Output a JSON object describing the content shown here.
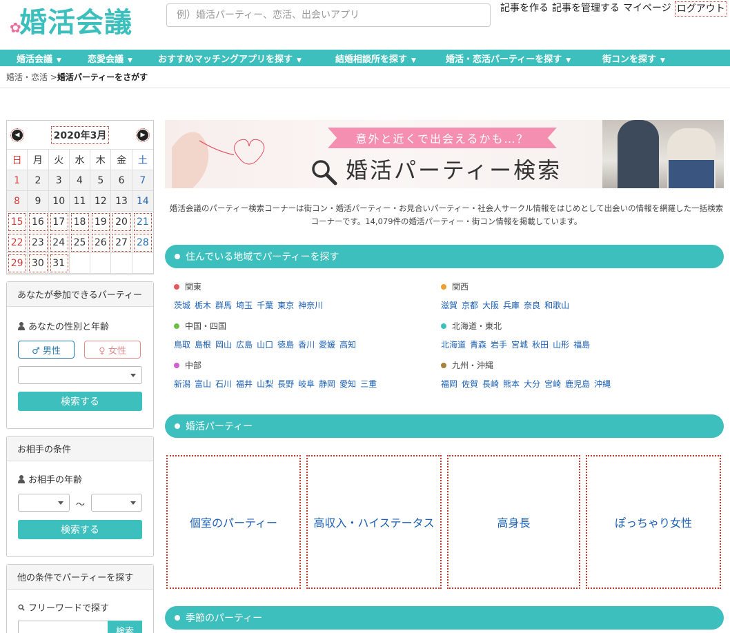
{
  "logo": {
    "text": "婚活会議",
    "flower": "✿"
  },
  "search": {
    "placeholder": "例）婚活パーティー、恋活、出会いアプリ"
  },
  "toplinks": [
    "記事を作る",
    "記事を管理する",
    "マイページ",
    "ログアウト"
  ],
  "nav": [
    "婚活会議",
    "恋愛会議",
    "おすすめマッチングアプリを探す",
    "結婚相談所を探す",
    "婚活・恋活パーティーを探す",
    "街コンを探す"
  ],
  "breadcrumb": {
    "parent": "婚活・恋活",
    "sep": ">",
    "current": "婚活パーティーをさがす"
  },
  "calendar": {
    "title": "2020年3月",
    "dow": [
      "日",
      "月",
      "火",
      "水",
      "木",
      "金",
      "土"
    ],
    "days": [
      "1",
      "2",
      "3",
      "4",
      "5",
      "6",
      "7",
      "8",
      "9",
      "10",
      "11",
      "12",
      "13",
      "14",
      "15",
      "16",
      "17",
      "18",
      "19",
      "20",
      "21",
      "22",
      "23",
      "24",
      "25",
      "26",
      "27",
      "28",
      "29",
      "30",
      "31"
    ]
  },
  "box1": {
    "title": "あなたが参加できるパーティー",
    "label": "あなたの性別と年齢",
    "male": "♂ 男性",
    "female": "♀ 女性",
    "search": "検索する"
  },
  "box2": {
    "title": "お相手の条件",
    "label": "お相手の年齢",
    "tilde": "～",
    "search": "検索する"
  },
  "box3": {
    "title": "他の条件でパーティーを探す",
    "label": "フリーワードで探す",
    "search": "検索"
  },
  "banner": {
    "pill": "意外と近くで出会えるかも…？",
    "title": "婚活パーティー検索"
  },
  "intro": "婚活会議のパーティー検索コーナーは街コン・婚活パーティー・お見合いパーティー・社会人サークル情報をはじめとして出会いの情報を網羅した一括検索コーナーです。14,079件の婚活パーティー・街コン情報を掲載しています。",
  "sections": {
    "area": "住んでいる地域でパーティーを探す",
    "party": "婚活パーティー",
    "season": "季節のパーティー"
  },
  "regions": [
    {
      "name": "関東",
      "color": "#e85a5a",
      "prefs": [
        "茨城",
        "栃木",
        "群馬",
        "埼玉",
        "千葉",
        "東京",
        "神奈川"
      ]
    },
    {
      "name": "関西",
      "color": "#f0a030",
      "prefs": [
        "滋賀",
        "京都",
        "大阪",
        "兵庫",
        "奈良",
        "和歌山"
      ]
    },
    {
      "name": "中国・四国",
      "color": "#6cc04a",
      "prefs": [
        "鳥取",
        "島根",
        "岡山",
        "広島",
        "山口",
        "徳島",
        "香川",
        "愛媛",
        "高知"
      ]
    },
    {
      "name": "北海道・東北",
      "color": "#3cbfbd",
      "prefs": [
        "北海道",
        "青森",
        "岩手",
        "宮城",
        "秋田",
        "山形",
        "福島"
      ]
    },
    {
      "name": "中部",
      "color": "#d060d0",
      "prefs": [
        "新潟",
        "富山",
        "石川",
        "福井",
        "山梨",
        "長野",
        "岐阜",
        "静岡",
        "愛知",
        "三重"
      ]
    },
    {
      "name": "九州・沖縄",
      "color": "#a88040",
      "prefs": [
        "福岡",
        "佐賀",
        "長崎",
        "熊本",
        "大分",
        "宮崎",
        "鹿児島",
        "沖縄"
      ]
    }
  ],
  "categories": [
    "個室のパーティー",
    "高収入・ハイステータス",
    "高身長",
    "ぽっちゃり女性"
  ],
  "colors": {
    "accent": "#3cbfbd",
    "pink": "#f58fb1"
  }
}
